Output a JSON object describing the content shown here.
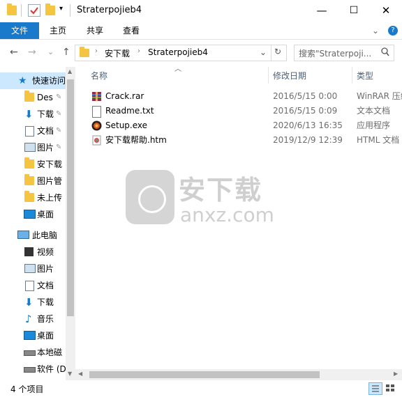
{
  "window": {
    "title": "Straterpojieb4",
    "minimize": "—",
    "maximize": "☐",
    "close": "✕",
    "accent_color": "#1979ca"
  },
  "ribbon": {
    "tabs": [
      "文件",
      "主页",
      "共享",
      "查看"
    ],
    "help": "?"
  },
  "navigation": {
    "back": "←",
    "forward": "→",
    "recent": "⌄",
    "up": "↑",
    "breadcrumb": [
      "安下载",
      "Straterpojieb4"
    ],
    "dropdown": "⌄",
    "refresh": "↻"
  },
  "search": {
    "placeholder": "搜索\"Straterpoji...",
    "icon": "search-icon"
  },
  "sidebar": {
    "quick_access_label": "快速访问",
    "quick_items": [
      {
        "label": "Des",
        "icon": "folder-icon",
        "pinned": true
      },
      {
        "label": "下载",
        "icon": "download-icon",
        "pinned": true
      },
      {
        "label": "文档",
        "icon": "document-icon",
        "pinned": true
      },
      {
        "label": "图片",
        "icon": "picture-icon",
        "pinned": true
      },
      {
        "label": "安下载",
        "icon": "folder-icon",
        "pinned": false
      },
      {
        "label": "图片管",
        "icon": "folder-icon",
        "pinned": false
      },
      {
        "label": "未上传",
        "icon": "folder-icon",
        "pinned": false
      },
      {
        "label": "桌面",
        "icon": "desktop-icon",
        "pinned": false
      }
    ],
    "this_pc_label": "此电脑",
    "pc_items": [
      {
        "label": "视频",
        "icon": "video-icon"
      },
      {
        "label": "图片",
        "icon": "picture-icon"
      },
      {
        "label": "文档",
        "icon": "document-icon"
      },
      {
        "label": "下载",
        "icon": "download-icon"
      },
      {
        "label": "音乐",
        "icon": "music-icon"
      },
      {
        "label": "桌面",
        "icon": "desktop-icon"
      },
      {
        "label": "本地磁",
        "icon": "drive-icon"
      },
      {
        "label": "软件 (D",
        "icon": "drive-icon"
      }
    ]
  },
  "file_list": {
    "columns": [
      "名称",
      "修改日期",
      "类型"
    ],
    "files": [
      {
        "name": "Crack.rar",
        "date": "2016/5/15 0:00",
        "type": "WinRAR 压缩",
        "icon": "winrar-icon"
      },
      {
        "name": "Readme.txt",
        "date": "2016/5/15 0:09",
        "type": "文本文档",
        "icon": "text-file-icon"
      },
      {
        "name": "Setup.exe",
        "date": "2020/6/13 16:35",
        "type": "应用程序",
        "icon": "setup-exe-icon"
      },
      {
        "name": "安下载帮助.htm",
        "date": "2019/12/9 12:39",
        "type": "HTML 文档",
        "icon": "html-file-icon"
      }
    ]
  },
  "status": {
    "item_count": "4 个项目"
  },
  "watermark": {
    "title": "安下载",
    "domain": "anxz.com"
  }
}
